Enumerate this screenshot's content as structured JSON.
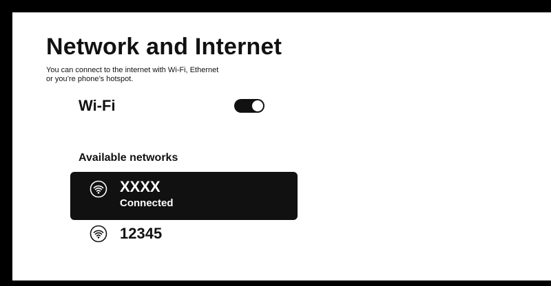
{
  "page": {
    "title": "Network and Internet",
    "description_line1": "You can connect to the internet with Wi-Fi, Ethernet",
    "description_line2": "or you’re phone’s hotspot."
  },
  "wifi": {
    "label": "Wi-Fi",
    "enabled": true
  },
  "networks": {
    "section_label": "Available networks",
    "items": [
      {
        "name": "XXXX",
        "status": "Connected",
        "selected": true,
        "icon": "wifi-icon"
      },
      {
        "name": "12345",
        "status": "",
        "selected": false,
        "icon": "wifi-icon"
      }
    ]
  },
  "colors": {
    "frame": "#000000",
    "background": "#ffffff",
    "text": "#111111",
    "selected_background": "#111111",
    "selected_text": "#ffffff"
  }
}
